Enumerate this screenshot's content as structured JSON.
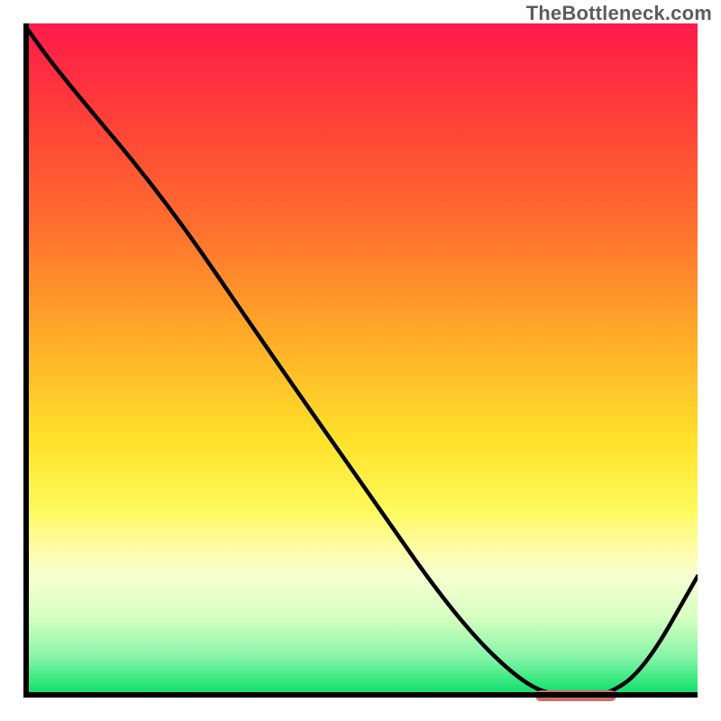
{
  "attribution": "TheBottleneck.com",
  "chart_data": {
    "type": "line",
    "title": "",
    "xlabel": "",
    "ylabel": "",
    "xlim": [
      0,
      100
    ],
    "ylim": [
      0,
      100
    ],
    "x": [
      0,
      5,
      21,
      36,
      50,
      64,
      74,
      80,
      86,
      92,
      100
    ],
    "values": [
      100,
      93,
      74,
      52,
      32,
      12,
      2,
      0,
      0,
      4,
      18
    ],
    "background_gradient": {
      "stops": [
        {
          "t": 0.0,
          "color": "#ff1a4b"
        },
        {
          "t": 0.12,
          "color": "#ff3a3a"
        },
        {
          "t": 0.3,
          "color": "#ff6f2e"
        },
        {
          "t": 0.48,
          "color": "#ffb128"
        },
        {
          "t": 0.62,
          "color": "#ffe22a"
        },
        {
          "t": 0.72,
          "color": "#fff95b"
        },
        {
          "t": 0.78,
          "color": "#fffca8"
        },
        {
          "t": 0.82,
          "color": "#f7ffd0"
        },
        {
          "t": 0.88,
          "color": "#d7ffc2"
        },
        {
          "t": 0.94,
          "color": "#86f5a8"
        },
        {
          "t": 0.98,
          "color": "#2be67a"
        },
        {
          "t": 1.0,
          "color": "#10d36b"
        }
      ]
    },
    "highlight_marker": {
      "x_start": 76,
      "x_end": 88,
      "y": 0,
      "color": "#d26b6b"
    }
  }
}
